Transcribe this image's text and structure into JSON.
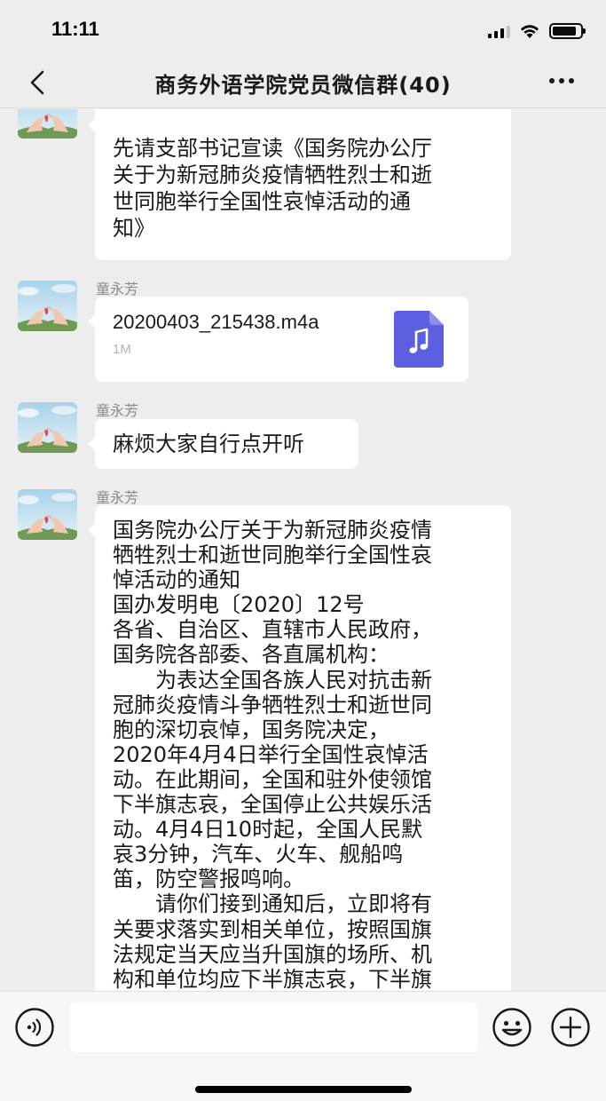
{
  "status_bar": {
    "time": "11:11",
    "battery_level": 0.85
  },
  "nav": {
    "title": "商务外语学院党员微信群(40)"
  },
  "messages": [
    {
      "sender": "",
      "text": "先请支部书记宣读《国务院办公厅\n关于为新冠肺炎疫情牺牲烈士和逝\n世同胞举行全国性哀悼活动的通\n知》"
    },
    {
      "sender": "童永芳",
      "file_name": "20200403_215438.m4a",
      "file_size": "1M",
      "file_icon": "music-file-icon"
    },
    {
      "sender": "童永芳",
      "text": "麻烦大家自行点开听"
    },
    {
      "sender": "童永芳",
      "text": "国务院办公厅关于为新冠肺炎疫情\n牺牲烈士和逝世同胞举行全国性哀\n悼活动的通知\n国办发明电〔2020〕12号\n各省、自治区、直辖市人民政府，\n国务院各部委、各直属机构：\n　　为表达全国各族人民对抗击新\n冠肺炎疫情斗争牺牲烈士和逝世同\n胞的深切哀悼，国务院决定，\n2020年4月4日举行全国性哀悼活\n动。在此期间，全国和驻外使领馆\n下半旗志哀，全国停止公共娱乐活\n动。4月4日10时起，全国人民默\n哀3分钟，汽车、火车、舰船鸣\n笛，防空警报鸣响。\n　　请你们接到通知后，立即将有\n关要求落实到相关单位，按照国旗\n法规定当天应当升国旗的场所、机\n构和单位均应下半旗志哀，下半旗"
    }
  ],
  "input_bar": {
    "placeholder": ""
  },
  "colors": {
    "background": "#ededed",
    "bubble": "#ffffff",
    "file_icon": "#5b5fe0",
    "sender": "#8a8a8a"
  }
}
